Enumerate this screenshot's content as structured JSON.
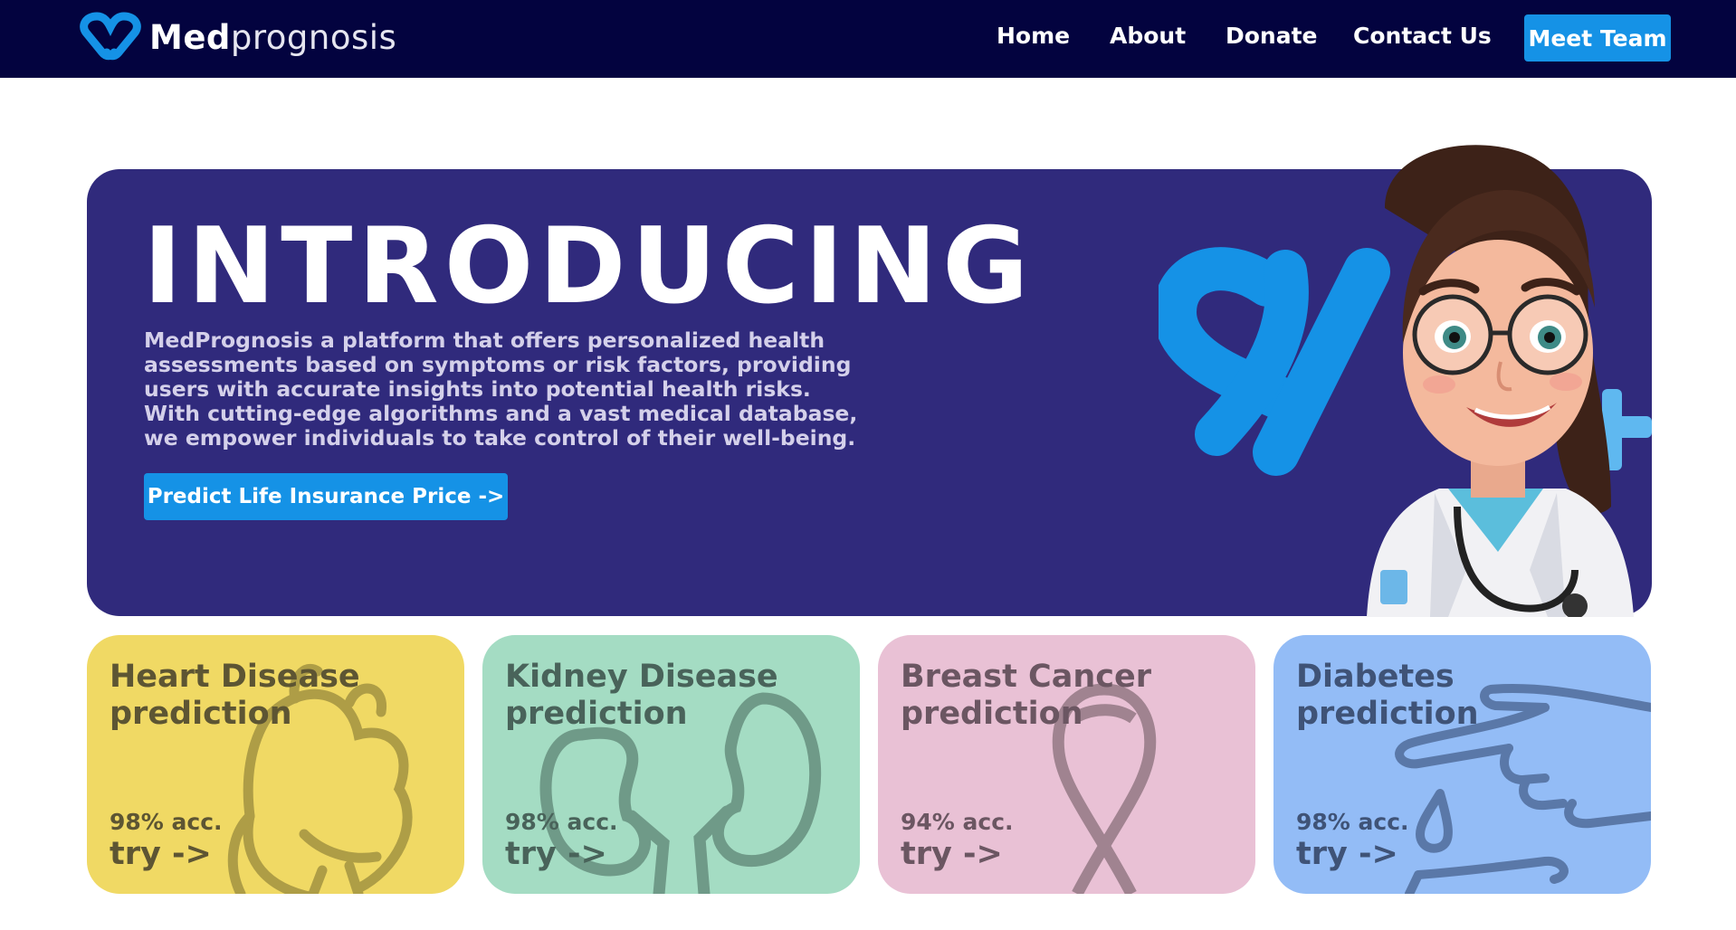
{
  "brand": {
    "name_bold": "Med",
    "name_light": "prognosis",
    "logo_icon": "heart-infinity-logo-icon",
    "color": "#1592e6"
  },
  "nav": {
    "links": [
      "Home",
      "About",
      "Donate",
      "Contact Us"
    ],
    "cta": "Meet Team",
    "background": "#03033f"
  },
  "hero": {
    "title": "INTRODUCING",
    "description": "MedPrognosis a platform that offers personalized health assessments based on symptoms or risk factors, providing users with accurate insights into potential health risks. With cutting-edge algorithms and a vast medical database, we empower individuals to take control of their well-being.",
    "button": "Predict Life Insurance Price ->",
    "background": "#302a7c",
    "illustration": "doctor-avatar-illustration"
  },
  "cards": [
    {
      "title_line1": "Heart Disease",
      "title_line2": "prediction",
      "accuracy": "98% acc.",
      "cta": "try ->",
      "bg": "#f0d964",
      "text": "#5d5533",
      "icon": "heart-organ-icon"
    },
    {
      "title_line1": "Kidney Disease",
      "title_line2": "prediction",
      "accuracy": "98% acc.",
      "cta": "try ->",
      "bg": "#a4dcc3",
      "text": "#49635a",
      "icon": "kidney-icon"
    },
    {
      "title_line1": "Breast Cancer",
      "title_line2": "prediction",
      "accuracy": "94% acc.",
      "cta": "try ->",
      "bg": "#e9c1d5",
      "text": "#6b5662",
      "icon": "ribbon-icon"
    },
    {
      "title_line1": "Diabetes",
      "title_line2": "prediction",
      "accuracy": "98% acc.",
      "cta": "try ->",
      "bg": "#93bcf6",
      "text": "#3f5377",
      "icon": "blood-drop-finger-icon"
    }
  ]
}
